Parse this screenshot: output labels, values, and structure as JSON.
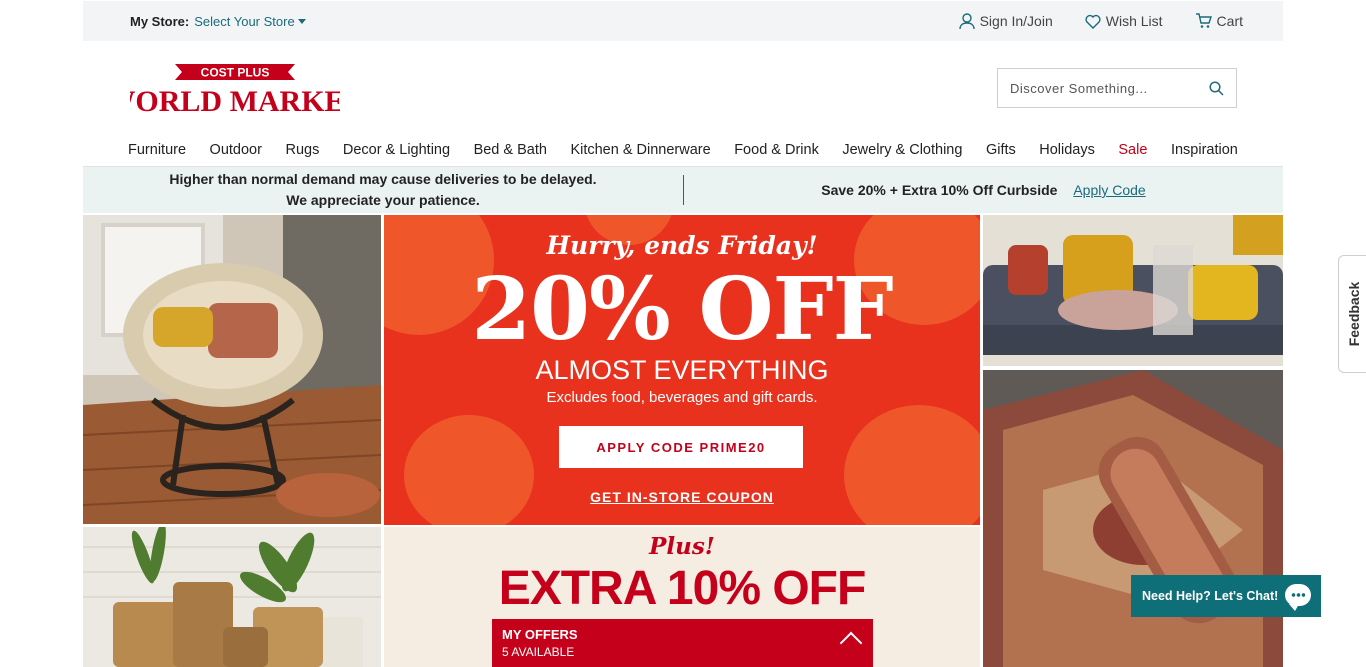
{
  "utility": {
    "store_label": "My Store:",
    "store_link": "Select Your Store",
    "sign_in": "Sign In/Join",
    "wish_list": "Wish List",
    "cart": "Cart"
  },
  "logo": {
    "top_text": "COST PLUS",
    "main_text": "WORLD MARKET"
  },
  "search": {
    "placeholder": "Discover Something..."
  },
  "nav": {
    "items": [
      "Furniture",
      "Outdoor",
      "Rugs",
      "Decor & Lighting",
      "Bed & Bath",
      "Kitchen & Dinnerware",
      "Food & Drink",
      "Jewelry & Clothing",
      "Gifts",
      "Holidays",
      "Sale",
      "Inspiration"
    ]
  },
  "notice": {
    "line1": "Higher than normal demand may cause deliveries to be delayed.",
    "line2": "We appreciate your patience.",
    "offer": "Save 20% + Extra 10% Off Curbside",
    "apply": "Apply Code"
  },
  "hero": {
    "hurry": "Hurry, ends Friday!",
    "headline": "20% OFF",
    "sub": "ALMOST EVERYTHING",
    "exclusions": "Excludes food, beverages and gift cards.",
    "button": "APPLY CODE PRIME20",
    "coupon": "GET IN-STORE COUPON"
  },
  "promo2": {
    "plus": "Plus!",
    "headline": "EXTRA 10% OFF"
  },
  "offers": {
    "title": "MY OFFERS",
    "count": "5 AVAILABLE"
  },
  "chat": {
    "label": "Need Help? Let's Chat!"
  },
  "feedback": {
    "label": "Feedback"
  },
  "colors": {
    "brand_red": "#c4001a",
    "teal": "#1a6b7c",
    "hero_red": "#e8321e"
  }
}
